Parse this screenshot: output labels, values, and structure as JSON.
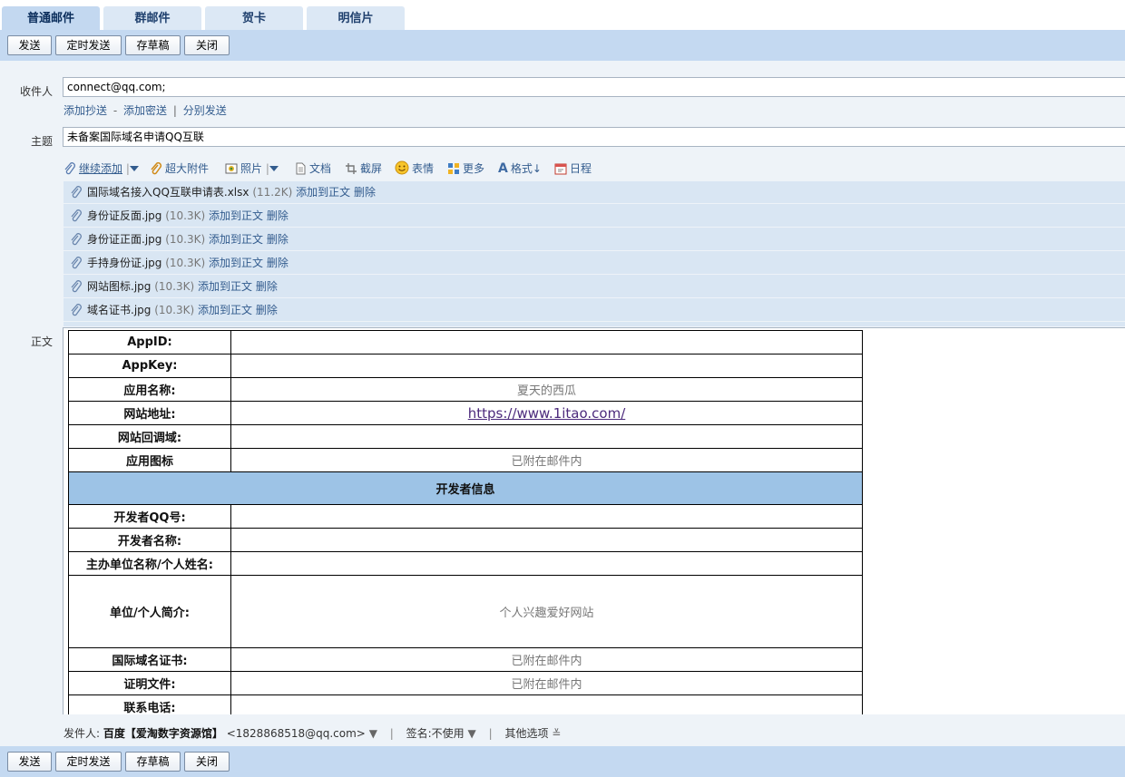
{
  "tabs": [
    "普通邮件",
    "群邮件",
    "贺卡",
    "明信片"
  ],
  "toolbar": {
    "send": "发送",
    "scheduled": "定时发送",
    "draft": "存草稿",
    "close": "关闭"
  },
  "form": {
    "to_label": "收件人",
    "to_value": "connect@qq.com;",
    "cc_links": {
      "add_cc": "添加抄送",
      "dash": "-",
      "add_bcc": "添加密送",
      "bar": "|",
      "separate": "分别发送"
    },
    "subject_label": "主题",
    "subject_value": "未备案国际域名申请QQ互联",
    "body_label": "正文"
  },
  "tools": {
    "continue_add": "继续添加",
    "big_attachment": "超大附件",
    "photo": "照片",
    "document": "文档",
    "screenshot": "截屏",
    "emoji": "表情",
    "more": "更多",
    "format": "格式",
    "schedule": "日程"
  },
  "attachments": [
    {
      "name": "国际域名接入QQ互联申请表.xlsx",
      "size": "(11.2K)",
      "add": "添加到正文",
      "del": "删除"
    },
    {
      "name": "身份证反面.jpg",
      "size": "(10.3K)",
      "add": "添加到正文",
      "del": "删除"
    },
    {
      "name": "身份证正面.jpg",
      "size": "(10.3K)",
      "add": "添加到正文",
      "del": "删除"
    },
    {
      "name": "手持身份证.jpg",
      "size": "(10.3K)",
      "add": "添加到正文",
      "del": "删除"
    },
    {
      "name": "网站图标.jpg",
      "size": "(10.3K)",
      "add": "添加到正文",
      "del": "删除"
    },
    {
      "name": "域名证书.jpg",
      "size": "(10.3K)",
      "add": "添加到正文",
      "del": "删除"
    }
  ],
  "table": {
    "appid": "AppID:",
    "appkey": "AppKey:",
    "app_name": "应用名称:",
    "app_name_value": "夏天的西瓜",
    "site_url": "网站地址:",
    "site_url_value": "https://www.1itao.com/",
    "callback": "网站回调域:",
    "app_icon": "应用图标",
    "app_icon_value": "已附在邮件内",
    "section": "开发者信息",
    "dev_qq": "开发者QQ号:",
    "dev_name": "开发者名称:",
    "sponsor": "主办单位名称/个人姓名:",
    "intro": "单位/个人简介:",
    "intro_value": "个人兴趣爱好网站",
    "domain_cert": "国际域名证书:",
    "domain_cert_value": "已附在邮件内",
    "proof": "证明文件:",
    "proof_value": "已附在邮件内",
    "phone": "联系电话:"
  },
  "sender": {
    "label": "发件人:",
    "name": "百度【爱淘数字资源馆】",
    "email": "<1828868518@qq.com>",
    "sep": "|",
    "sig_label": "签名:",
    "sig_value": "不使用",
    "other": "其他选项"
  }
}
